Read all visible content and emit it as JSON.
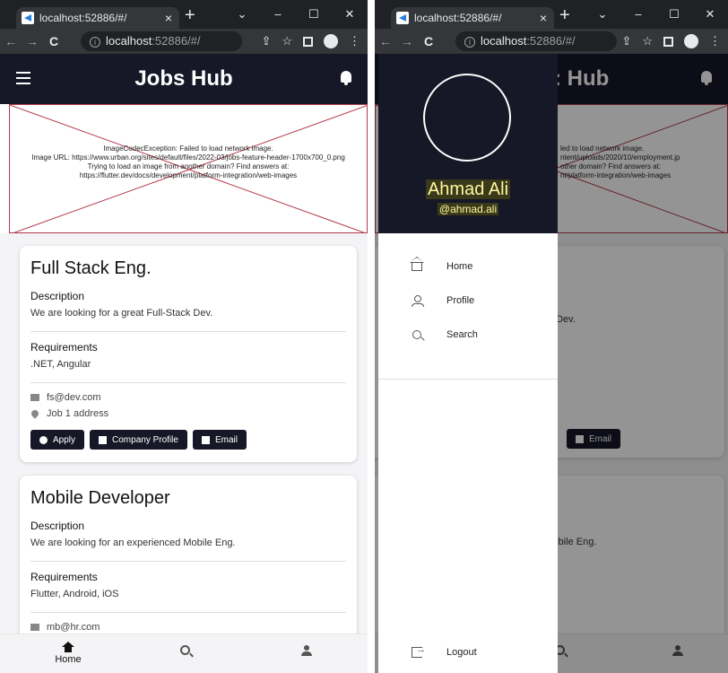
{
  "browser": {
    "tab_title": "localhost:52886/#/",
    "url_host": "localhost",
    "url_port": ":52886/#/",
    "new_tab": "+",
    "tab_close": "×",
    "controls": [
      "⌄",
      "–",
      "☐",
      "✕"
    ]
  },
  "app": {
    "title": "Jobs Hub",
    "error_lines": [
      "ImageCodecException: Failed to load network image.",
      "Image URL: https://www.urban.org/sites/default/files/2022-03/jobs-feature-header-1700x700_0.png",
      "Trying to load an image from another domain? Find answers at:",
      "https://flutter.dev/docs/development/platform-integration/web-images"
    ],
    "error_lines_right": [
      "led to load network image.",
      "ntent/uploads/2020/10/employment.jp",
      "other domain? Find answers at:",
      "nt/platform-integration/web-images"
    ]
  },
  "jobs": [
    {
      "title": "Full Stack Eng.",
      "description_label": "Description",
      "description": "We are looking for a great Full-Stack Dev.",
      "requirements_label": "Requirements",
      "requirements": ".NET, Angular",
      "email": "fs@dev.com",
      "address": "Job 1 address"
    },
    {
      "title": "Mobile Developer",
      "description_label": "Description",
      "description": "We are looking for an experienced Mobile Eng.",
      "requirements_label": "Requirements",
      "requirements": "Flutter, Android, iOS",
      "email": "mb@hr.com"
    }
  ],
  "buttons": {
    "apply": "Apply",
    "company_profile": "Company Profile",
    "email": "Email"
  },
  "bottom_nav": {
    "home": "Home"
  },
  "drawer": {
    "name": "Ahmad Ali",
    "handle": "@ahmad.ali",
    "items": [
      "Home",
      "Profile",
      "Search"
    ],
    "logout": "Logout"
  },
  "right_peek": {
    "title_part": ": Hub",
    "desc1_part": ". Dev.",
    "desc2_part": "lobile Eng.",
    "email_btn": "Email"
  },
  "colors": {
    "appbar": "#161727",
    "drawer_name": "#fff8a0"
  }
}
